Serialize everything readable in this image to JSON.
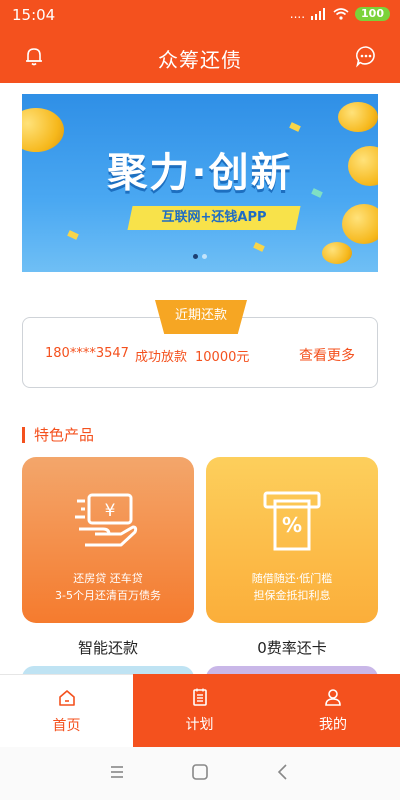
{
  "status": {
    "time": "15:04",
    "signal": "....",
    "battery": "100"
  },
  "header": {
    "title": "众筹还债"
  },
  "banner": {
    "headline": "聚力·创新",
    "tag": "互联网+还钱APP",
    "slides": 2,
    "active_slide": 1
  },
  "recent": {
    "tab_label": "近期还款",
    "phone": "180****3547",
    "status": "成功放款",
    "amount": "10000元",
    "more": "查看更多"
  },
  "section": {
    "title": "特色产品"
  },
  "products": [
    {
      "name": "智能还款",
      "line1": "还房贷 还车贷",
      "line2": "3-5个月还清百万债务"
    },
    {
      "name": "0费率还卡",
      "line1": "随借随还·低门槛",
      "line2": "担保金抵扣利息"
    }
  ],
  "tabbar": {
    "home": "首页",
    "plan": "计划",
    "mine": "我的"
  },
  "colors": {
    "brand": "#f4511e",
    "tab_badge": "#f6a623"
  }
}
